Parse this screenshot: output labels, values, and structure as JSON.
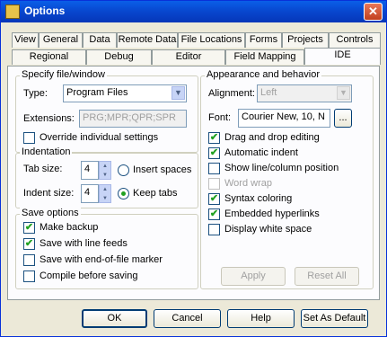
{
  "window": {
    "title": "Options",
    "close_glyph": "✕",
    "title_icon": "options-app-icon"
  },
  "tabs_row1": [
    "View",
    "General",
    "Data",
    "Remote Data",
    "File Locations",
    "Forms",
    "Projects",
    "Controls"
  ],
  "tabs_row2": [
    "Regional",
    "Debug",
    "Editor",
    "Field Mapping",
    "IDE"
  ],
  "active_tab": "IDE",
  "specify": {
    "label": "Specify file/window",
    "type_label": "Type:",
    "type_value": "Program Files",
    "extensions_label": "Extensions:",
    "extensions_value": "PRG;MPR;QPR;SPR",
    "override_label": "Override individual settings"
  },
  "indentation": {
    "label": "Indentation",
    "tab_size_label": "Tab size:",
    "tab_size_value": "4",
    "indent_size_label": "Indent size:",
    "indent_size_value": "4",
    "insert_spaces_label": "Insert spaces",
    "keep_tabs_label": "Keep tabs"
  },
  "save_options": {
    "label": "Save options",
    "items": [
      {
        "label": "Make backup",
        "checked": true
      },
      {
        "label": "Save with line feeds",
        "checked": true
      },
      {
        "label": "Save with end-of-file marker",
        "checked": false
      },
      {
        "label": "Compile before saving",
        "checked": false
      }
    ]
  },
  "appearance": {
    "label": "Appearance and behavior",
    "alignment_label": "Alignment:",
    "alignment_value": "Left",
    "font_label": "Font:",
    "font_value": "Courier New, 10, N",
    "font_button": "...",
    "items": [
      {
        "label": "Drag and drop editing",
        "checked": true,
        "disabled": false
      },
      {
        "label": "Automatic indent",
        "checked": true,
        "disabled": false
      },
      {
        "label": "Show line/column position",
        "checked": false,
        "disabled": false
      },
      {
        "label": "Word wrap",
        "checked": false,
        "disabled": true
      },
      {
        "label": "Syntax coloring",
        "checked": true,
        "disabled": false
      },
      {
        "label": "Embedded hyperlinks",
        "checked": true,
        "disabled": false
      },
      {
        "label": "Display white space",
        "checked": false,
        "disabled": false
      }
    ],
    "apply_label": "Apply",
    "reset_all_label": "Reset All"
  },
  "buttons": {
    "ok": "OK",
    "cancel": "Cancel",
    "help": "Help",
    "set_default": "Set As Default"
  },
  "glyphs": {
    "check": "✔",
    "dropdown": "▼",
    "spin_up": "▲",
    "spin_down": "▼"
  }
}
